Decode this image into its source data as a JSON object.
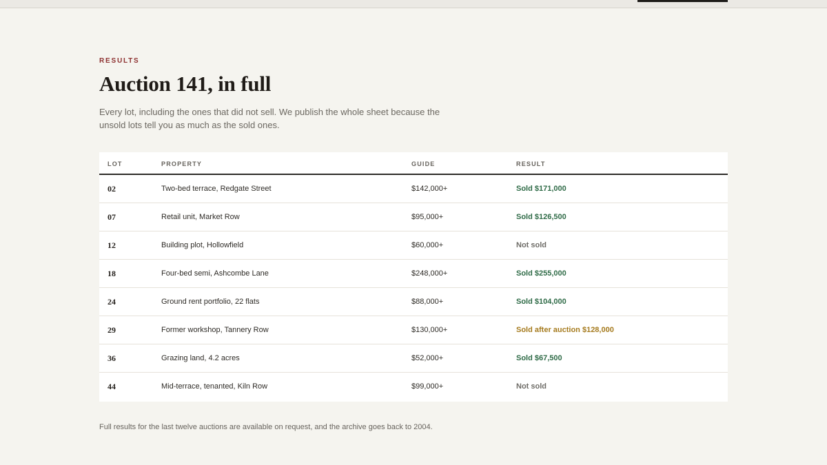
{
  "section": {
    "eyebrow": "RESULTS",
    "title": "Auction 141, in full",
    "intro": "Every lot, including the ones that did not sell. We publish the whole sheet because the unsold lots tell you as much as the sold ones."
  },
  "table": {
    "headers": [
      "LOT",
      "PROPERTY",
      "GUIDE",
      "RESULT"
    ],
    "rows": [
      {
        "lot": "02",
        "property": "Two-bed terrace, Redgate Street",
        "guide": "$142,000+",
        "result": "Sold $171,000",
        "status": "sold"
      },
      {
        "lot": "07",
        "property": "Retail unit, Market Row",
        "guide": "$95,000+",
        "result": "Sold $126,500",
        "status": "sold"
      },
      {
        "lot": "12",
        "property": "Building plot, Hollowfield",
        "guide": "$60,000+",
        "result": "Not sold",
        "status": "unsold"
      },
      {
        "lot": "18",
        "property": "Four-bed semi, Ashcombe Lane",
        "guide": "$248,000+",
        "result": "Sold $255,000",
        "status": "sold"
      },
      {
        "lot": "24",
        "property": "Ground rent portfolio, 22 flats",
        "guide": "$88,000+",
        "result": "Sold $104,000",
        "status": "sold"
      },
      {
        "lot": "29",
        "property": "Former workshop, Tannery Row",
        "guide": "$130,000+",
        "result": "Sold after auction $128,000",
        "status": "after"
      },
      {
        "lot": "36",
        "property": "Grazing land, 4.2 acres",
        "guide": "$52,000+",
        "result": "Sold $67,500",
        "status": "sold"
      },
      {
        "lot": "44",
        "property": "Mid-terrace, tenanted, Kiln Row",
        "guide": "$99,000+",
        "result": "Not sold",
        "status": "unsold"
      }
    ]
  },
  "footer": {
    "note": "Full results for the last twelve auctions are available on request, and the archive goes back to 2004."
  },
  "colors": {
    "background": "#f5f4ef",
    "eyebrow": "#8d3030",
    "sold": "#2f6b47",
    "not_sold": "#6e6c67",
    "sold_after": "#a57a1d"
  }
}
